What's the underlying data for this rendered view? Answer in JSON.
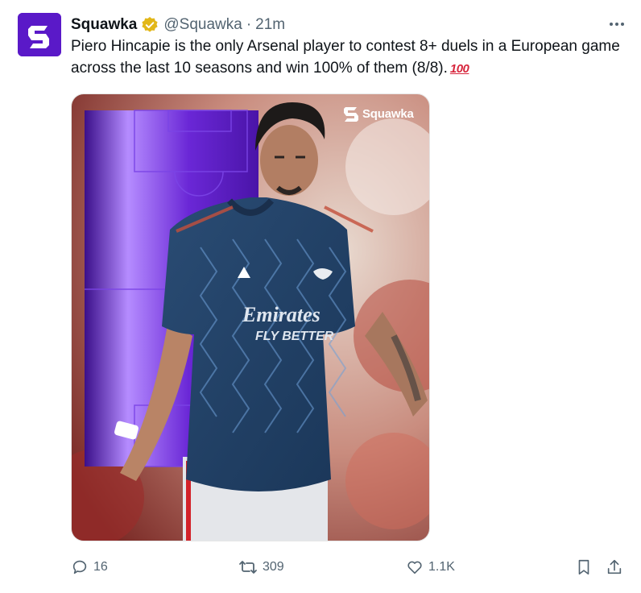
{
  "author": {
    "display_name": "Squawka",
    "handle": "@Squawka",
    "separator": "·",
    "time": "21m",
    "verified": true,
    "brand_color": "#5a19c8",
    "verified_color": "#e2b719"
  },
  "tweet": {
    "text": "Piero Hincapie is the only Arsenal player to contest 8+ duels in a European game across the last 10 seasons and win 100% of them (8/8).",
    "emoji": "100"
  },
  "media": {
    "watermark": "Squawka",
    "shirt_sponsor_line1": "Emirates",
    "shirt_sponsor_line2": "FLY BETTER"
  },
  "actions": {
    "replies": "16",
    "retweets": "309",
    "likes": "1.1K"
  },
  "icons": {
    "reply": "reply-icon",
    "retweet": "retweet-icon",
    "like": "heart-icon",
    "bookmark": "bookmark-icon",
    "share": "share-icon",
    "more": "more-icon",
    "verified": "verified-badge-icon"
  }
}
